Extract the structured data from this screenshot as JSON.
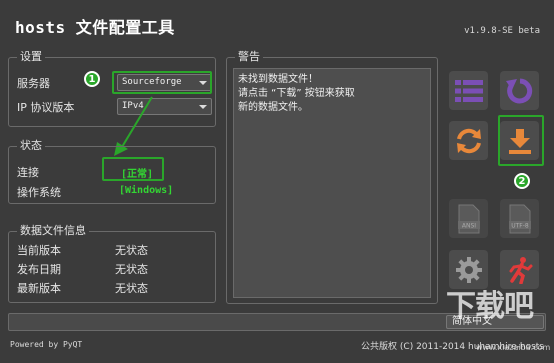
{
  "app": {
    "title": "hosts 文件配置工具",
    "version": "v1.9.8-SE beta"
  },
  "settings": {
    "title": "设置",
    "server_label": "服务器",
    "server_value": "Sourceforge",
    "ip_label": "IP 协议版本",
    "ip_value": "IPv4"
  },
  "status": {
    "title": "状态",
    "connection_label": "连接",
    "connection_value": "[正常]",
    "os_label": "操作系统",
    "os_value": "[Windows]"
  },
  "data_info": {
    "title": "数据文件信息",
    "rows": [
      {
        "label": "当前版本",
        "value": "无状态"
      },
      {
        "label": "发布日期",
        "value": "无状态"
      },
      {
        "label": "最新版本",
        "value": "无状态"
      }
    ]
  },
  "warning": {
    "title": "警告",
    "lines": [
      "未找到数据文件！",
      "请点击 “下载” 按钮来获取",
      "新的数据文件。"
    ]
  },
  "toolbar": {
    "buttons": [
      "list-icon",
      "refresh-icon",
      "sync-icon",
      "download-icon",
      "ansi-file-icon",
      "utf8-file-icon",
      "gear-icon",
      "exit-run-icon"
    ],
    "ansi_text": "ANSI",
    "utf8_text": "UTF-8"
  },
  "annotations": {
    "badge_1": "1",
    "badge_2": "2"
  },
  "language": "简体中文",
  "footer": {
    "powered_by": "Powered by PyQT",
    "copyright": "公共版权 (C) 2011-2014 huhamhire-hosts"
  },
  "watermark": {
    "text": "下载吧",
    "url": "www.xiazaiba.com"
  },
  "colors": {
    "accent_purple": "#7b4fb5",
    "accent_orange": "#e8883a",
    "accent_red": "#e03a3a",
    "highlight_green": "#2aa62a",
    "status_green": "#33d633"
  }
}
